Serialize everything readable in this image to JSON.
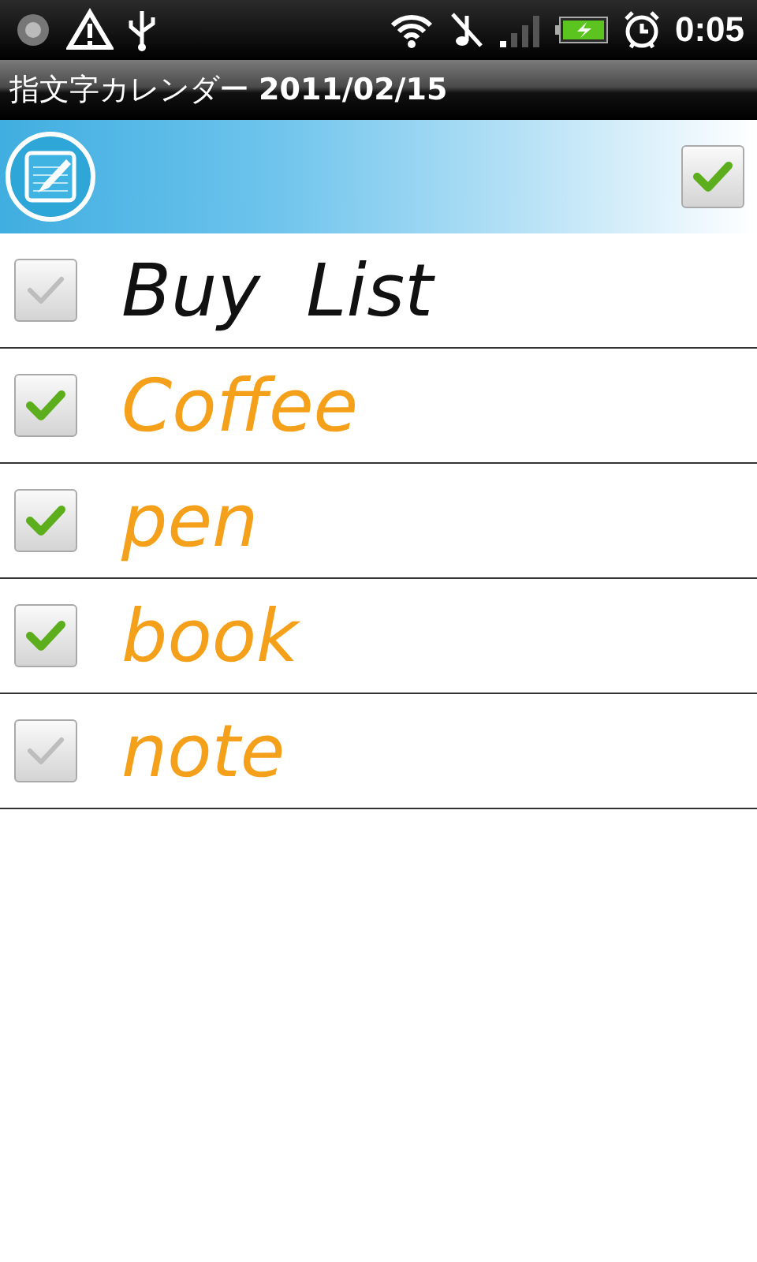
{
  "status_bar": {
    "time": "0:05"
  },
  "title_bar": {
    "title": "指文字カレンダー **2011/02/15**"
  },
  "toolbar": {
    "select_all_checked": true
  },
  "items": [
    {
      "text": "Buy  List",
      "checked": false,
      "color": "#111111"
    },
    {
      "text": "Coffee",
      "checked": true,
      "color": "#f5a01a"
    },
    {
      "text": "pen",
      "checked": true,
      "color": "#f5a01a"
    },
    {
      "text": "book",
      "checked": true,
      "color": "#f5a01a"
    },
    {
      "text": "note",
      "checked": false,
      "color": "#f5a01a"
    }
  ]
}
